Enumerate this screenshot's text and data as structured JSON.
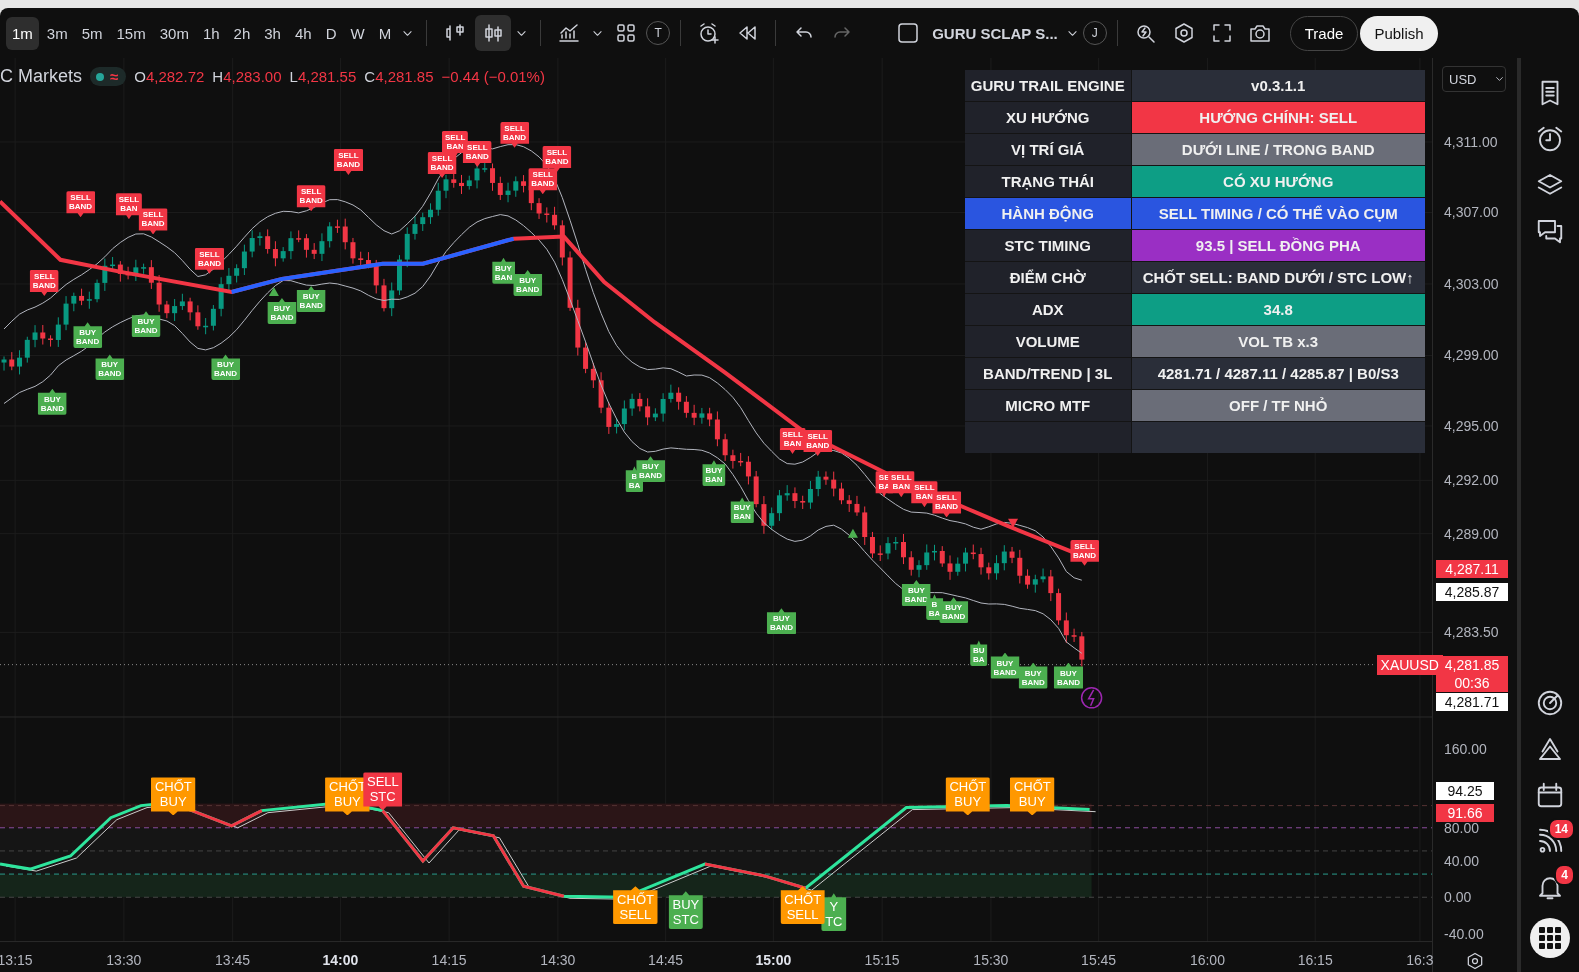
{
  "toolbar": {
    "timeframes": [
      {
        "label": "1m",
        "selected": true
      },
      {
        "label": "3m",
        "selected": false
      },
      {
        "label": "5m",
        "selected": false
      },
      {
        "label": "15m",
        "selected": false
      },
      {
        "label": "30m",
        "selected": false
      },
      {
        "label": "1h",
        "selected": false
      },
      {
        "label": "2h",
        "selected": false
      },
      {
        "label": "3h",
        "selected": false
      },
      {
        "label": "4h",
        "selected": false
      },
      {
        "label": "D",
        "selected": false
      },
      {
        "label": "W",
        "selected": false
      },
      {
        "label": "M",
        "selected": false
      }
    ],
    "chart_styles": [
      {
        "selected": false
      },
      {
        "selected": true
      }
    ],
    "template_letter": "T",
    "indicator_name": "GURU SCLAP S...",
    "avatar_letter": "J",
    "trade_button": "Trade",
    "publish_button": "Publish"
  },
  "legend": {
    "symbol": "C Markets",
    "toggle_symbol": "≈",
    "ohlc": [
      {
        "key": "O",
        "value": "4,282.72"
      },
      {
        "key": "H",
        "value": "4,283.00"
      },
      {
        "key": "L",
        "value": "4,281.55"
      },
      {
        "key": "C",
        "value": "4,281.85"
      }
    ],
    "change": "−0.44 (−0.01%)"
  },
  "currency": "USD",
  "info_table": {
    "title": "GURU TRAIL ENGINE",
    "version": "v0.3.1.1",
    "rows": [
      {
        "label": "XU HƯỚNG",
        "value": "HƯỚNG CHÍNH: SELL",
        "color": "#f23645",
        "label_highlighted": false
      },
      {
        "label": "VỊ TRÍ GIÁ",
        "value": "DƯỚI LINE / TRONG BAND",
        "color": "#6a6d78",
        "label_highlighted": false
      },
      {
        "label": "TRẠNG THÁI",
        "value": "CÓ XU HƯỚNG",
        "color": "#0d9e85",
        "label_highlighted": false
      },
      {
        "label": "HÀNH ĐỘNG",
        "value": "SELL TIMING / CÓ THỂ VÀO CỤM",
        "color": "#2a55e0",
        "label_highlighted": true
      },
      {
        "label": "STC TIMING",
        "value": "93.5 | SELL ĐỒNG PHA",
        "color": "#9a2fc4",
        "label_highlighted": false
      },
      {
        "label": "ĐIỂM CHỜ",
        "value": "CHỐT SELL: BAND DƯỚI / STC LOW↑",
        "color": "#2a2e39",
        "label_highlighted": false
      },
      {
        "label": "ADX",
        "value": "34.8",
        "color": "#0d9e85",
        "label_highlighted": false
      },
      {
        "label": "VOLUME",
        "value": "VOL TB x.3",
        "color": "#6a6d78",
        "label_highlighted": false
      },
      {
        "label": "BAND/TREND | 3L",
        "value": "4281.71 / 4287.11 / 4285.87 | B0/S3",
        "color": "#2a2e39",
        "label_highlighted": false
      },
      {
        "label": "MICRO MTF",
        "value": "OFF / TF NHỎ",
        "color": "#6a6d78",
        "label_highlighted": false
      }
    ]
  },
  "price_signals": [
    {
      "text": "SELL BAND",
      "kind": "sell"
    },
    {
      "text": "SELL BAN",
      "kind": "sell"
    },
    {
      "text": "SELL BAND",
      "kind": "sell"
    },
    {
      "text": "SELL BAND",
      "kind": "sell"
    },
    {
      "text": "SELL BAND",
      "kind": "sell"
    },
    {
      "text": "SELL BAND",
      "kind": "sell"
    },
    {
      "text": "SELL BAND",
      "kind": "sell"
    },
    {
      "text": "SELL BAN",
      "kind": "sell"
    },
    {
      "text": "SELL BAND",
      "kind": "sell"
    },
    {
      "text": "SELL BAND",
      "kind": "sell"
    },
    {
      "text": "SELL BAND",
      "kind": "sell"
    },
    {
      "text": "SELL BAND",
      "kind": "sell"
    },
    {
      "text": "SELL BAND",
      "kind": "sell"
    },
    {
      "text": "SELL BAN",
      "kind": "sell"
    },
    {
      "text": "SELL BAND",
      "kind": "sell"
    },
    {
      "text": "SE BA",
      "kind": "sell"
    },
    {
      "text": "SELL BAN",
      "kind": "sell"
    },
    {
      "text": "SELL BAN",
      "kind": "sell"
    },
    {
      "text": "SELL BAND",
      "kind": "sell"
    },
    {
      "text": "SELL BAND",
      "kind": "sell"
    },
    {
      "text": "BUY BAND",
      "kind": "buy"
    },
    {
      "text": "BUY BAND",
      "kind": "buy"
    },
    {
      "text": "BUY BAND",
      "kind": "buy"
    },
    {
      "text": "BUY BAND",
      "kind": "buy"
    },
    {
      "text": "BUY BAND",
      "kind": "buy"
    },
    {
      "text": "BUY BAND",
      "kind": "buy"
    },
    {
      "text": "BUY BAND",
      "kind": "buy"
    },
    {
      "text": "BUY BAN",
      "kind": "buy"
    },
    {
      "text": "BUY BAND",
      "kind": "buy"
    },
    {
      "text": "B BA",
      "kind": "buy"
    },
    {
      "text": "BUY BAND",
      "kind": "buy"
    },
    {
      "text": "BUY BAN",
      "kind": "buy"
    },
    {
      "text": "BUY BAN",
      "kind": "buy"
    },
    {
      "text": "BUY BAND",
      "kind": "buy"
    },
    {
      "text": "BUY BAND",
      "kind": "buy"
    },
    {
      "text": "B BA",
      "kind": "buy"
    },
    {
      "text": "BUY BAND",
      "kind": "buy"
    },
    {
      "text": "BU BA",
      "kind": "buy"
    },
    {
      "text": "BUY BAND",
      "kind": "buy"
    },
    {
      "text": "BUY BAND",
      "kind": "buy"
    },
    {
      "text": "BUY BAND",
      "kind": "buy"
    }
  ],
  "oscillator_signals": [
    {
      "text": "CHỐT BUY",
      "kind": "exit_buy"
    },
    {
      "text": "CHỐT BUY",
      "kind": "exit_buy"
    },
    {
      "text": "SELL STC",
      "kind": "sell"
    },
    {
      "text": "CHỐT BUY",
      "kind": "exit_buy"
    },
    {
      "text": "CHỐT BUY",
      "kind": "exit_buy"
    },
    {
      "text": "CHỐT SELL",
      "kind": "exit_sell"
    },
    {
      "text": "BUY STC",
      "kind": "buy"
    },
    {
      "text": "Y TC",
      "kind": "buy"
    },
    {
      "text": "CHỐT SELL",
      "kind": "exit_sell"
    }
  ],
  "price_axis": {
    "ticks": [
      "4,311.00",
      "4,307.00",
      "4,303.00",
      "4,299.00",
      "4,295.00",
      "4,292.00",
      "4,289.00",
      "4,283.50"
    ],
    "labels": [
      {
        "text": "4,287.11",
        "color": "#f23645"
      },
      {
        "text": "4,285.87",
        "color": "#ffffff"
      },
      {
        "text": "4,281.85",
        "color": "#f23645",
        "countdown": "00:36"
      },
      {
        "text": "4,281.71",
        "color": "#ffffff"
      }
    ],
    "symbol_label": "XAUUSD"
  },
  "oscillator_axis": {
    "ticks": [
      "160.00",
      "80.00",
      "40.00",
      "0.00",
      "-40.00"
    ],
    "labels": [
      {
        "text": "94.25",
        "color": "#ffffff"
      },
      {
        "text": "91.66",
        "color": "#f23645"
      }
    ]
  },
  "time_axis": [
    {
      "label": "13:15",
      "major": false
    },
    {
      "label": "13:30",
      "major": false
    },
    {
      "label": "13:45",
      "major": false
    },
    {
      "label": "14:00",
      "major": true
    },
    {
      "label": "14:15",
      "major": false
    },
    {
      "label": "14:30",
      "major": false
    },
    {
      "label": "14:45",
      "major": false
    },
    {
      "label": "15:00",
      "major": true
    },
    {
      "label": "15:15",
      "major": false
    },
    {
      "label": "15:30",
      "major": false
    },
    {
      "label": "15:45",
      "major": false
    },
    {
      "label": "16:00",
      "major": false
    },
    {
      "label": "16:15",
      "major": false
    },
    {
      "label": "16:3",
      "major": false
    }
  ],
  "sidebar": {
    "feed_badge": "14",
    "alerts_badge": "4"
  }
}
